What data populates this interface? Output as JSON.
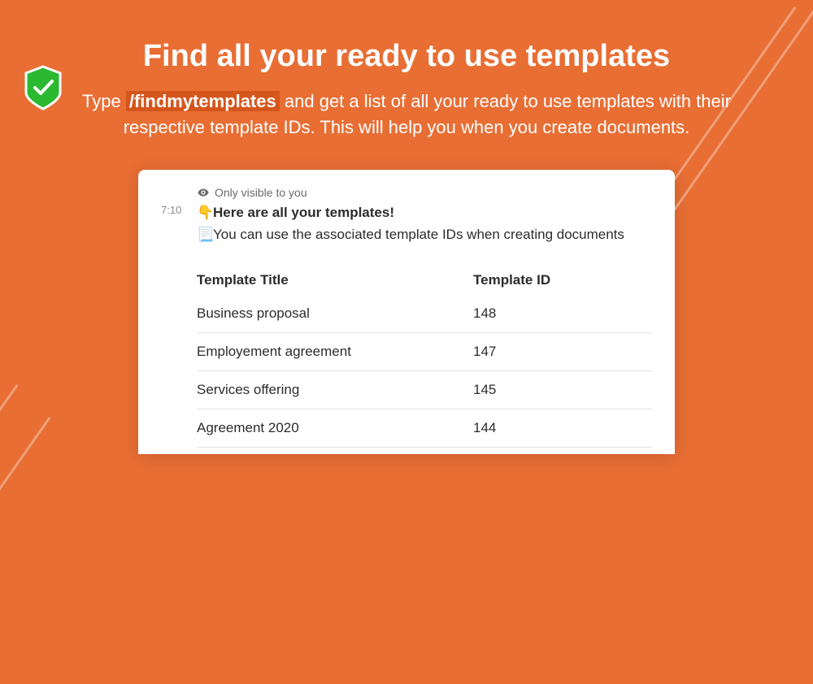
{
  "hero": {
    "title": "Find all your ready to use templates",
    "sub_pre": "Type ",
    "command": "/findmytemplates",
    "sub_post": " and get a list of all your ready to use templates with their respective template IDs. This will help you when you create documents."
  },
  "message": {
    "visibility": "Only visible to you",
    "timestamp": "7:10",
    "line1_emoji": "👇",
    "line1_text": "Here are all your templates!",
    "line2_emoji": "📃",
    "line2_text": "You can use the associated template IDs when creating documents"
  },
  "table": {
    "headers": {
      "title": "Template Title",
      "id": "Template ID"
    },
    "rows": [
      {
        "title": "Business proposal",
        "id": "148"
      },
      {
        "title": "Employement agreement",
        "id": "147"
      },
      {
        "title": "Services offering",
        "id": "145"
      },
      {
        "title": "Agreement 2020",
        "id": "144"
      }
    ]
  }
}
